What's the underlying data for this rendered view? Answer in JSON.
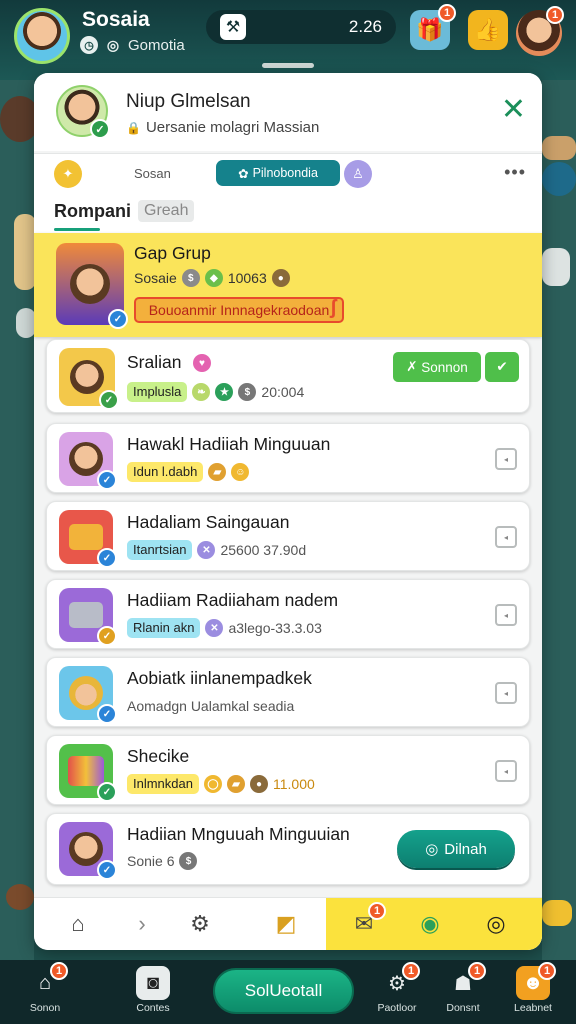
{
  "topbar": {
    "name": "Sosaia",
    "sub_label": "Gomotia",
    "time": "2.26",
    "badge_count": "1"
  },
  "modal": {
    "title": "Niup Glmelsan",
    "subtitle": "Uersanie molagri Massian",
    "tabbar": {
      "label": "Sosan",
      "pill_label": "Pilnobondia",
      "more": "•••"
    },
    "section": {
      "title": "Rompani",
      "chip": "Greah"
    }
  },
  "list": [
    {
      "title": "Gap Grup",
      "meta": "Sosaie",
      "value": "10063",
      "banner": "Bouoanmir Innnagekraodoan",
      "highlight": true
    },
    {
      "title": "Sralian",
      "chip": "Implusla",
      "value": "20:004",
      "action_label": "Sonnon"
    },
    {
      "title": "Hawakl Hadiiah Minguuan",
      "chip": "Idun l.dabh"
    },
    {
      "title": "Hadaliam Saingauan",
      "chip": "Itanrtsian",
      "value": "25600 37.90d"
    },
    {
      "title": "Hadiiam Radiiaham nadem",
      "chip": "Rlanin akn",
      "value": "a3lego-33.3.03"
    },
    {
      "title": "Aobiatk iinlanempadkek",
      "meta": "Aomadgn Ualamkal seadia"
    },
    {
      "title": "Shecike",
      "chip": "Inlmnkdan",
      "value": "11.000"
    },
    {
      "title": "Hadiian Mnguuah Minguuian",
      "meta": "Sonie 6",
      "action_label": "Dilnah"
    }
  ],
  "bottom_nav": {
    "items": [
      "Sonon",
      "Contes",
      "Paotloor",
      "Donsnt",
      "Leabnet"
    ],
    "main_label": "SolUeotall",
    "badge_count": "1"
  },
  "colors": {
    "accent_teal": "#15828c",
    "highlight_yellow": "#fae45a",
    "action_green": "#4fbf4a",
    "badge_orange": "#f05a28"
  }
}
